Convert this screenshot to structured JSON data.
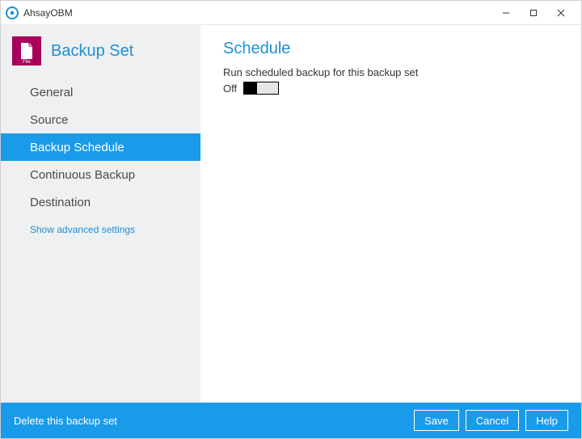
{
  "window": {
    "title": "AhsayOBM"
  },
  "sidebar": {
    "title": "Backup Set",
    "icon_label": "File",
    "items": [
      {
        "label": "General"
      },
      {
        "label": "Source"
      },
      {
        "label": "Backup Schedule"
      },
      {
        "label": "Continuous Backup"
      },
      {
        "label": "Destination"
      }
    ],
    "advanced": "Show advanced settings"
  },
  "main": {
    "title": "Schedule",
    "description": "Run scheduled backup for this backup set",
    "toggle_state_label": "Off"
  },
  "footer": {
    "delete_label": "Delete this backup set",
    "save": "Save",
    "cancel": "Cancel",
    "help": "Help"
  }
}
